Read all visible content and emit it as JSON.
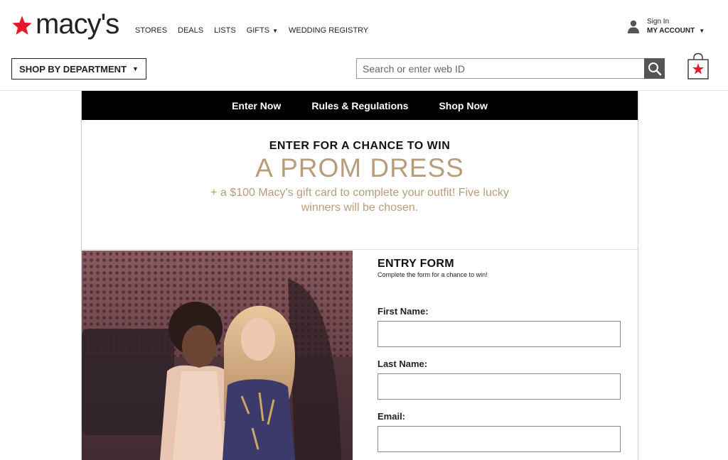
{
  "brand": {
    "logo_text": "macy's",
    "accent": "#e21a2c"
  },
  "topnav": {
    "items": [
      {
        "label": "STORES"
      },
      {
        "label": "DEALS"
      },
      {
        "label": "LISTS"
      },
      {
        "label": "GIFTS",
        "has_dropdown": true
      },
      {
        "label": "WEDDING REGISTRY"
      }
    ]
  },
  "account": {
    "sign_in": "Sign In",
    "my_account": "MY ACCOUNT"
  },
  "department": {
    "label": "SHOP BY DEPARTMENT"
  },
  "search": {
    "placeholder": "Search or enter web ID",
    "value": ""
  },
  "promo_nav": {
    "items": [
      "Enter Now",
      "Rules & Regulations",
      "Shop Now"
    ]
  },
  "hero": {
    "kicker": "ENTER FOR A CHANCE TO WIN",
    "prize": "A PROM DRESS",
    "subtext": "+ a $100 Macy's gift card to complete your outfit! Five lucky winners will be chosen.",
    "accent_color": "#b89d7a"
  },
  "form": {
    "title": "ENTRY FORM",
    "subtitle": "Complete the form for a chance to win!",
    "fields": [
      {
        "label": "First Name:",
        "value": ""
      },
      {
        "label": "Last Name:",
        "value": ""
      },
      {
        "label": "Email:",
        "value": ""
      }
    ]
  },
  "icons": [
    "star-logo-icon",
    "chevron-down-icon",
    "user-icon",
    "search-icon",
    "shopping-bag-icon"
  ]
}
